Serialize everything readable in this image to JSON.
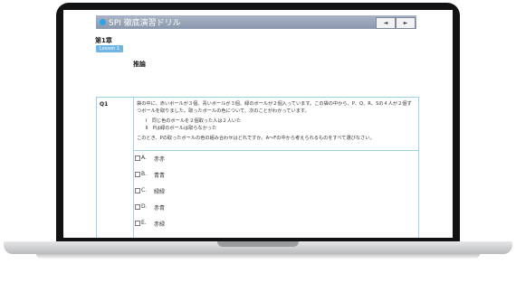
{
  "app": {
    "title": "SPI 徹底演習ドリル",
    "prev_label": "◄",
    "next_label": "►"
  },
  "page": {
    "chapter": "第1章",
    "lesson": "Lesson 1",
    "topic": "推論"
  },
  "question": {
    "label": "Q1",
    "intro": "袋の中に、赤いボールが３個、青いボールが３個、緑のボールが２個入っています。この袋の中から、P、Q、R、Sの４人が２個ずつボールを取りました。取ったボールの色について、次のことがわかっています。",
    "conditions": [
      "Ⅰ　同じ色のボールを２個取った人は２人いた",
      "Ⅱ　Pは緑のボールは取らなかった"
    ],
    "prompt": "このとき、Pの取ったボールの色の組み合わせはどれですか。A〜Fの中から考えられるものをすべて選びなさい。",
    "choices": [
      {
        "key": "A.",
        "text": "赤赤"
      },
      {
        "key": "B.",
        "text": "青青"
      },
      {
        "key": "C.",
        "text": "緑緑"
      },
      {
        "key": "D.",
        "text": "赤青"
      },
      {
        "key": "E.",
        "text": "赤緑"
      }
    ]
  }
}
